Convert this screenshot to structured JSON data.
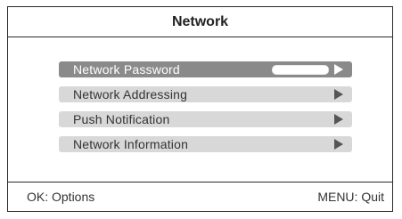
{
  "header": {
    "title": "Network"
  },
  "menu": {
    "items": [
      {
        "label": "Network Password",
        "selected": true
      },
      {
        "label": "Network Addressing",
        "selected": false
      },
      {
        "label": "Push Notification",
        "selected": false
      },
      {
        "label": "Network Information",
        "selected": false
      }
    ]
  },
  "footer": {
    "ok_hint": "OK: Options",
    "menu_hint": "MENU: Quit"
  },
  "colors": {
    "selected_bg": "#8a8a8a",
    "item_bg": "#d8d8d8",
    "border": "#2b2b2b"
  },
  "icons": {
    "arrow": "triangle-right-icon"
  }
}
